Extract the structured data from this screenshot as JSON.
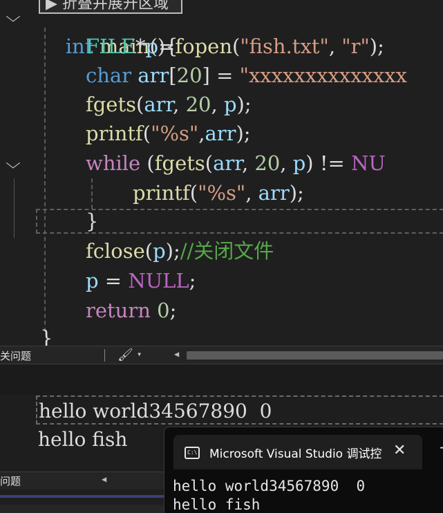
{
  "editor": {
    "hint_box": "▶ 折叠并展开区域",
    "lines": {
      "l0_kw": "int",
      "l0_fn": "main",
      "l0_rest": "(){",
      "l1_type": "FILE",
      "l1_star": "*",
      "l1_var": "p",
      "l1_eq": "=",
      "l1_fn": "fopen",
      "l1_open": "(",
      "l1_str1": "\"fish.txt\"",
      "l1_comma": ", ",
      "l1_str2": "\"r\"",
      "l1_close": ");",
      "l2_kw": "char",
      "l2_var": "arr",
      "l2_br1": "[",
      "l2_num": "20",
      "l2_br2": "] = ",
      "l2_str": "\"xxxxxxxxxxxxxx",
      "l3_fn": "fgets",
      "l3_open": "(",
      "l3_var1": "arr",
      "l3_c1": ", ",
      "l3_num": "20",
      "l3_c2": ", ",
      "l3_var2": "p",
      "l3_close": ");",
      "l4_fn": "printf",
      "l4_open": "(",
      "l4_str": "\"%s\"",
      "l4_c": ",",
      "l4_var": "arr",
      "l4_close": ");",
      "l5_kw": "while",
      "l5_a": " (",
      "l5_fn": "fgets",
      "l5_b": "(",
      "l5_var1": "arr",
      "l5_c1": ", ",
      "l5_num": "20",
      "l5_c2": ", ",
      "l5_var2": "p",
      "l5_c3": ") != ",
      "l5_mac": "NU",
      "l6_fn": "printf",
      "l6_open": "(",
      "l6_str": "\"%s\"",
      "l6_c": ", ",
      "l6_var": "arr",
      "l6_close": ");",
      "l7": "}",
      "l8_fn": "fclose",
      "l8_open": "(",
      "l8_var": "p",
      "l8_close": ");",
      "l8_cmt": "//关闭文件",
      "l9_var": "p",
      "l9_eq": " = ",
      "l9_mac": "NULL",
      "l9_semi": ";",
      "l10_kw": "return",
      "l10_sp": " ",
      "l10_num": "0",
      "l10_semi": ";",
      "l11": "}"
    }
  },
  "error_toolbar": {
    "label": "关问题"
  },
  "output": {
    "line1": "hello world34567890  0",
    "line2": "hello fish"
  },
  "bottom_toolbar": {
    "label": "问题"
  },
  "console": {
    "icon_text": "C:\\",
    "title": "Microsoft Visual Studio 调试控",
    "close": "✕",
    "plus": "+",
    "body_line1": "hello world34567890  0",
    "body_line2": "hello fish"
  },
  "icons": {
    "fold_icon": "⌵",
    "brush_icon": "🖌",
    "caret_icon": "▾",
    "scroll_left_icon": "◀"
  }
}
